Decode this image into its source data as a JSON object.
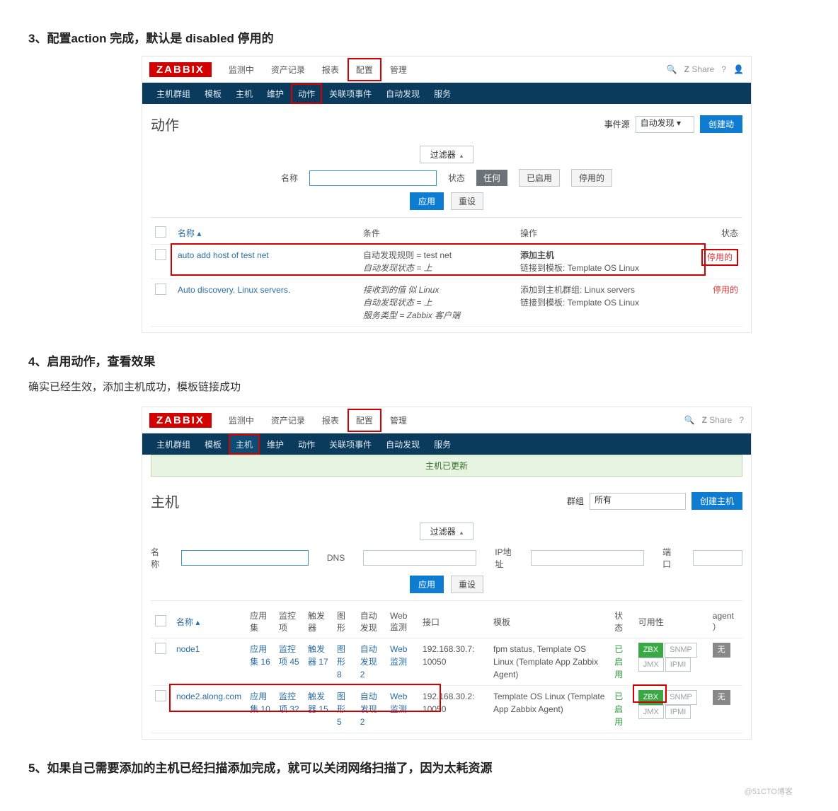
{
  "sections": {
    "s3_title": "3、配置action 完成，默认是 disabled 停用的",
    "s4_title": "4、启用动作，查看效果",
    "s4_lead": "确实已经生效，添加主机成功，模板链接成功",
    "s5_title": "5、如果自己需要添加的主机已经扫描添加完成，就可以关闭网络扫描了，因为太耗资源"
  },
  "watermark": "@51CTO博客",
  "zabbix": {
    "logo": "ZABBIX",
    "share": "Share",
    "help": "?",
    "topmenu": [
      "监测中",
      "资产记录",
      "报表",
      "配置",
      "管理"
    ],
    "submenu1": [
      "主机群组",
      "模板",
      "主机",
      "维护",
      "动作",
      "关联项事件",
      "自动发现",
      "服务"
    ],
    "submenu2": [
      "主机群组",
      "模板",
      "主机",
      "维护",
      "动作",
      "关联项事件",
      "自动发现",
      "服务"
    ]
  },
  "shot1": {
    "page_title": "动作",
    "event_source_label": "事件源",
    "event_source_value": "自动发现",
    "create_btn": "创建动",
    "filter_label": "过滤器",
    "name_label": "名称",
    "status_label": "状态",
    "status_any": "任何",
    "status_enabled": "已启用",
    "status_disabled": "停用的",
    "apply": "应用",
    "reset": "重设",
    "cols": {
      "name": "名称 ▴",
      "cond": "条件",
      "op": "操作",
      "status": "状态"
    },
    "rows": [
      {
        "name": "auto add host of test net",
        "cond_lines": [
          "自动发现规则 = test net",
          "自动发现状态 = 上"
        ],
        "op_lines": [
          "添加主机",
          "链接到模板: Template OS Linux"
        ],
        "status": "停用的"
      },
      {
        "name": "Auto discovery. Linux servers.",
        "cond_lines": [
          "接收到的值 似 Linux",
          "自动发现状态 = 上",
          "服务类型 = Zabbix 客户端"
        ],
        "op_lines": [
          "添加到主机群组: Linux servers",
          "链接到模板: Template OS Linux"
        ],
        "status": "停用的"
      }
    ]
  },
  "shot2": {
    "banner": "主机已更新",
    "page_title": "主机",
    "group_label": "群组",
    "group_value": "所有",
    "create_btn": "创建主机",
    "filter_label": "过滤器",
    "f_name": "名称",
    "f_dns": "DNS",
    "f_ip": "IP地址",
    "f_port": "端口",
    "apply": "应用",
    "reset": "重设",
    "cols": {
      "name": "名称 ▴",
      "apps": "应用集",
      "items": "监控项",
      "triggers": "触发器",
      "graphs": "图形",
      "discovery": "自动发现",
      "web": "Web监测",
      "iface": "接口",
      "templates": "模板",
      "status": "状态",
      "avail": "可用性",
      "agent": "agent ）"
    },
    "rows": [
      {
        "name": "node1",
        "apps": "应用集 16",
        "items": "监控项 45",
        "triggers": "触发器 17",
        "graphs": "图形 8",
        "discovery": "自动发现 2",
        "web": "Web监测",
        "iface": "192.168.30.7: 10050",
        "templates": "fpm status, Template OS Linux (Template App Zabbix Agent)",
        "status": "已启用",
        "avail": {
          "zbx": "ZBX",
          "snmp": "SNMP",
          "jmx": "JMX",
          "ipmi": "IPMI"
        },
        "agent": "无"
      },
      {
        "name": "node2.along.com",
        "apps": "应用集 10",
        "items": "监控项 32",
        "triggers": "触发器 15",
        "graphs": "图形 5",
        "discovery": "自动发现 2",
        "web": "Web监测",
        "iface": "192.168.30.2: 10050",
        "templates": "Template OS Linux (Template App Zabbix Agent)",
        "status": "已启用",
        "avail": {
          "zbx": "ZBX",
          "snmp": "SNMP",
          "jmx": "JMX",
          "ipmi": "IPMI"
        },
        "agent": "无"
      }
    ]
  }
}
